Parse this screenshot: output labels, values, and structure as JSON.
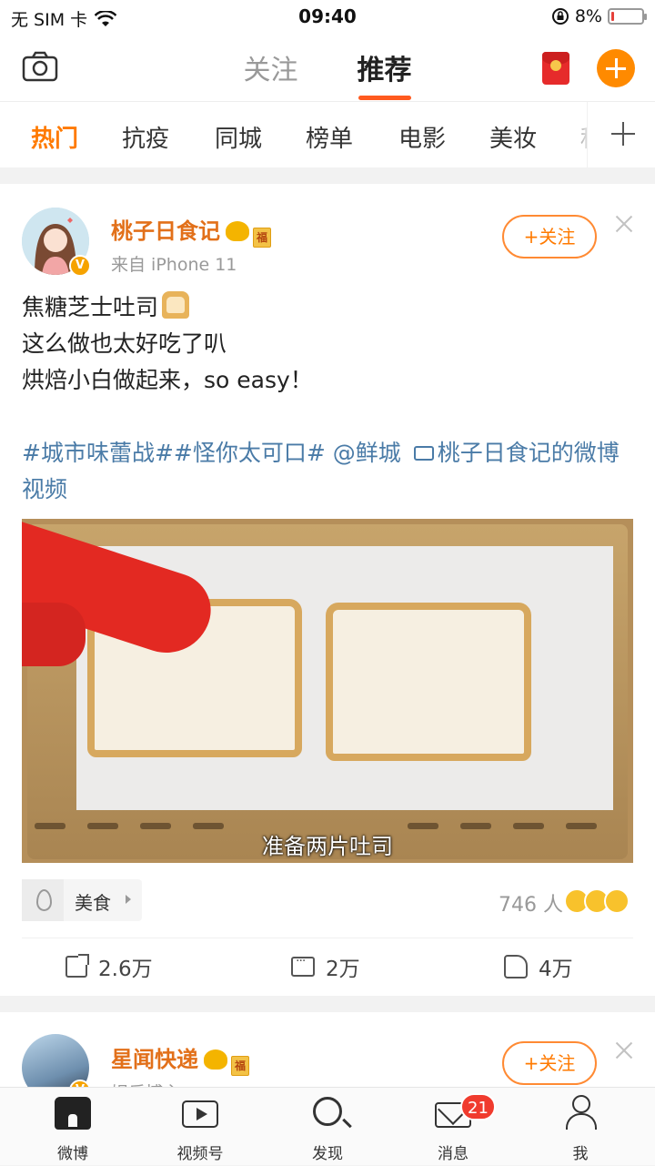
{
  "status_bar": {
    "carrier": "无 SIM 卡",
    "time": "09:40",
    "battery": "8%",
    "battery_level": 0.08
  },
  "top_nav": {
    "tabs": [
      "关注",
      "推荐"
    ],
    "active_tab": "推荐",
    "icons": [
      "camera-icon",
      "red-packet-icon",
      "compose-plus-icon"
    ]
  },
  "channels": {
    "items": [
      "热门",
      "抗疫",
      "同城",
      "榜单",
      "电影",
      "美妆",
      "种"
    ],
    "active": "热门",
    "more_icon": "plus-icon"
  },
  "posts": [
    {
      "author": "桃子日食记",
      "source": "来自 iPhone 11",
      "follow_label": "+关注",
      "text_lines": [
        "焦糖芝士吐司",
        "这么做也太好吃了叭",
        "烘焙小白做起来，so easy！"
      ],
      "tags": [
        "#城市味蕾战#",
        "#怪你太可口#",
        "@鲜城",
        "桃子日食记的微博视频"
      ],
      "video_caption": "准备两片吐司",
      "topic": "美食",
      "reactions": "746 人",
      "actions": {
        "share": "2.6万",
        "comment": "2万",
        "like": "4万"
      }
    },
    {
      "author": "星闻快递",
      "source": "娱乐博主",
      "follow_label": "+关注"
    }
  ],
  "tab_bar": {
    "items": [
      {
        "label": "微博",
        "icon": "home-icon"
      },
      {
        "label": "视频号",
        "icon": "video-icon"
      },
      {
        "label": "发现",
        "icon": "search-icon"
      },
      {
        "label": "消息",
        "icon": "mail-icon",
        "badge": "21"
      },
      {
        "label": "我",
        "icon": "profile-icon"
      }
    ]
  },
  "colors": {
    "accent": "#ff7a00",
    "link": "#4a7ba7",
    "badge": "#f03b2e"
  }
}
